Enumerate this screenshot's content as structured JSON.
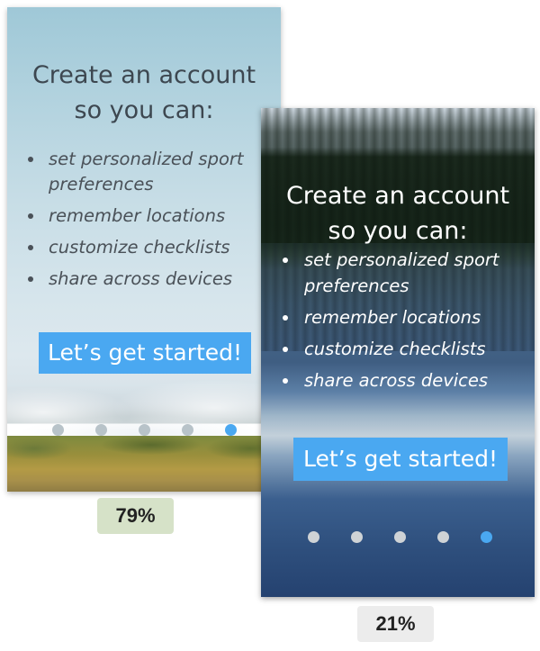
{
  "variant_a": {
    "title_line1": "Create an account",
    "title_line2": "so you can:",
    "bullets": [
      {
        "line1": "set personalized sport",
        "line2": "preferences"
      },
      {
        "line1": "remember locations",
        "line2": ""
      },
      {
        "line1": "customize checklists",
        "line2": ""
      },
      {
        "line1": "share across devices",
        "line2": ""
      }
    ],
    "cta_label": "Let’s get started!",
    "page_count": 5,
    "active_page": 5,
    "percent": "79%"
  },
  "variant_b": {
    "title_line1": "Create an account",
    "title_line2": "so you can:",
    "bullets": [
      {
        "line1": "set personalized sport",
        "line2": "preferences"
      },
      {
        "line1": "remember locations",
        "line2": ""
      },
      {
        "line1": "customize checklists",
        "line2": ""
      },
      {
        "line1": "share across devices",
        "line2": ""
      }
    ],
    "cta_label": "Let’s get started!",
    "page_count": 5,
    "active_page": 5,
    "percent": "21%"
  },
  "colors": {
    "accent": "#4aa8f1",
    "badge_a_bg": "#d6e2c8",
    "badge_b_bg": "#ececec"
  }
}
